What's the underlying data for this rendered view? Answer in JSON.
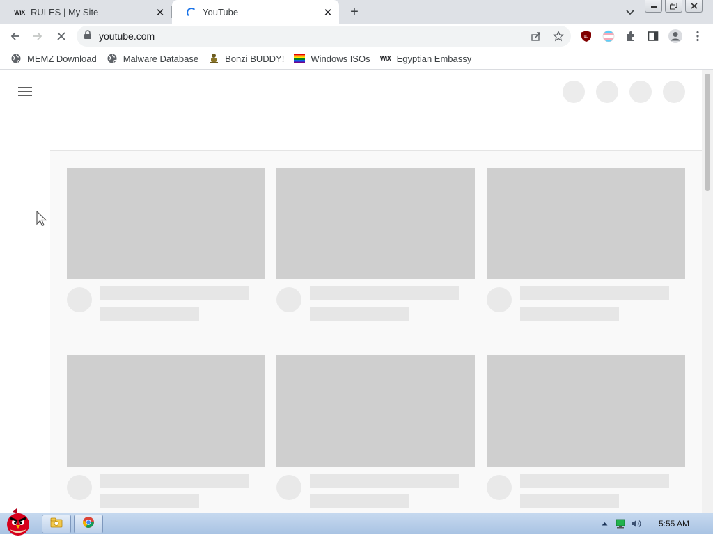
{
  "tabs": [
    {
      "title": "RULES | My Site",
      "favicon": "wix-logo",
      "favicon_text": "WiX",
      "active": false
    },
    {
      "title": "YouTube",
      "favicon": "loading-spinner",
      "active": true
    }
  ],
  "window_controls": [
    "minimize",
    "restore",
    "close"
  ],
  "toolbar": {
    "url": "youtube.com",
    "icons": [
      "back-arrow-icon",
      "forward-arrow-icon",
      "stop-loading-icon",
      "lock-icon",
      "share-icon",
      "star-icon",
      "ublock-icon",
      "trans-flag-extension-icon",
      "puzzle-extension-icon",
      "side-panel-icon",
      "profile-icon",
      "menu-kebab-icon"
    ]
  },
  "bookmarks": [
    {
      "label": "MEMZ Download",
      "icon": "globe-icon"
    },
    {
      "label": "Malware Database",
      "icon": "globe-icon"
    },
    {
      "label": "Bonzi BUDDY!",
      "icon": "bonzi-icon"
    },
    {
      "label": "Windows ISOs",
      "icon": "rainbow-flag-icon"
    },
    {
      "label": "Egyptian Embassy",
      "icon": "wix-logo",
      "icon_text": "WiX"
    }
  ],
  "page": {
    "state": "loading-skeleton",
    "video_cards": 6
  },
  "taskbar": {
    "start_icon": "angry-bird-icon",
    "pinned": [
      "explorer-folder-icon",
      "chrome-icon"
    ],
    "tray_icons": [
      "chevron-up-icon",
      "network-icon",
      "volume-icon"
    ],
    "clock": "5:55 AM"
  },
  "colors": {
    "tab_strip": "#dee1e6",
    "skeleton_thumb": "#cfcfcf",
    "skeleton_line": "#e6e6e6",
    "spinner": "#1a73e8",
    "taskbar": "#b5cdea"
  }
}
